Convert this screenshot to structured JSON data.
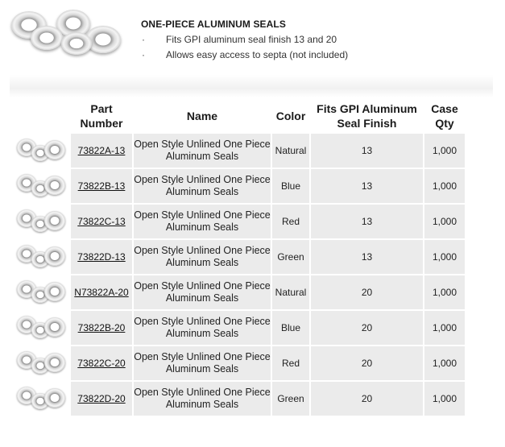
{
  "header": {
    "title": "ONE-PIECE ALUMINUM SEALS",
    "bullets": [
      "Fits GPI aluminum seal finish 13 and 20",
      "Allows easy access to septa (not included)"
    ],
    "bullet_marker": "·",
    "photo_icon": "aluminum-seals-photo"
  },
  "table": {
    "columns": {
      "part_number": "Part Number",
      "name": "Name",
      "color": "Color",
      "finish": "Fits GPI Aluminum Seal Finish",
      "qty": "Case Qty"
    },
    "rows": [
      {
        "part": "73822A-13",
        "name": "Open Style Unlined One Piece Aluminum Seals",
        "color": "Natural",
        "finish": "13",
        "qty": "1,000"
      },
      {
        "part": "73822B-13",
        "name": "Open Style Unlined One Piece Aluminum Seals",
        "color": "Blue",
        "finish": "13",
        "qty": "1,000"
      },
      {
        "part": "73822C-13",
        "name": "Open Style Unlined One Piece Aluminum Seals",
        "color": "Red",
        "finish": "13",
        "qty": "1,000"
      },
      {
        "part": "73822D-13",
        "name": "Open Style Unlined One Piece Aluminum Seals",
        "color": "Green",
        "finish": "13",
        "qty": "1,000"
      },
      {
        "part": "N73822A-20",
        "name": "Open Style Unlined One Piece Aluminum Seals",
        "color": "Natural",
        "finish": "20",
        "qty": "1,000"
      },
      {
        "part": "73822B-20",
        "name": "Open Style Unlined One Piece Aluminum Seals",
        "color": "Blue",
        "finish": "20",
        "qty": "1,000"
      },
      {
        "part": "73822C-20",
        "name": "Open Style Unlined One Piece Aluminum Seals",
        "color": "Red",
        "finish": "20",
        "qty": "1,000"
      },
      {
        "part": "73822D-20",
        "name": "Open Style Unlined One Piece Aluminum Seals",
        "color": "Green",
        "finish": "20",
        "qty": "1,000"
      }
    ]
  },
  "colors": {
    "row_background": "#ebebeb",
    "text": "#222222"
  }
}
